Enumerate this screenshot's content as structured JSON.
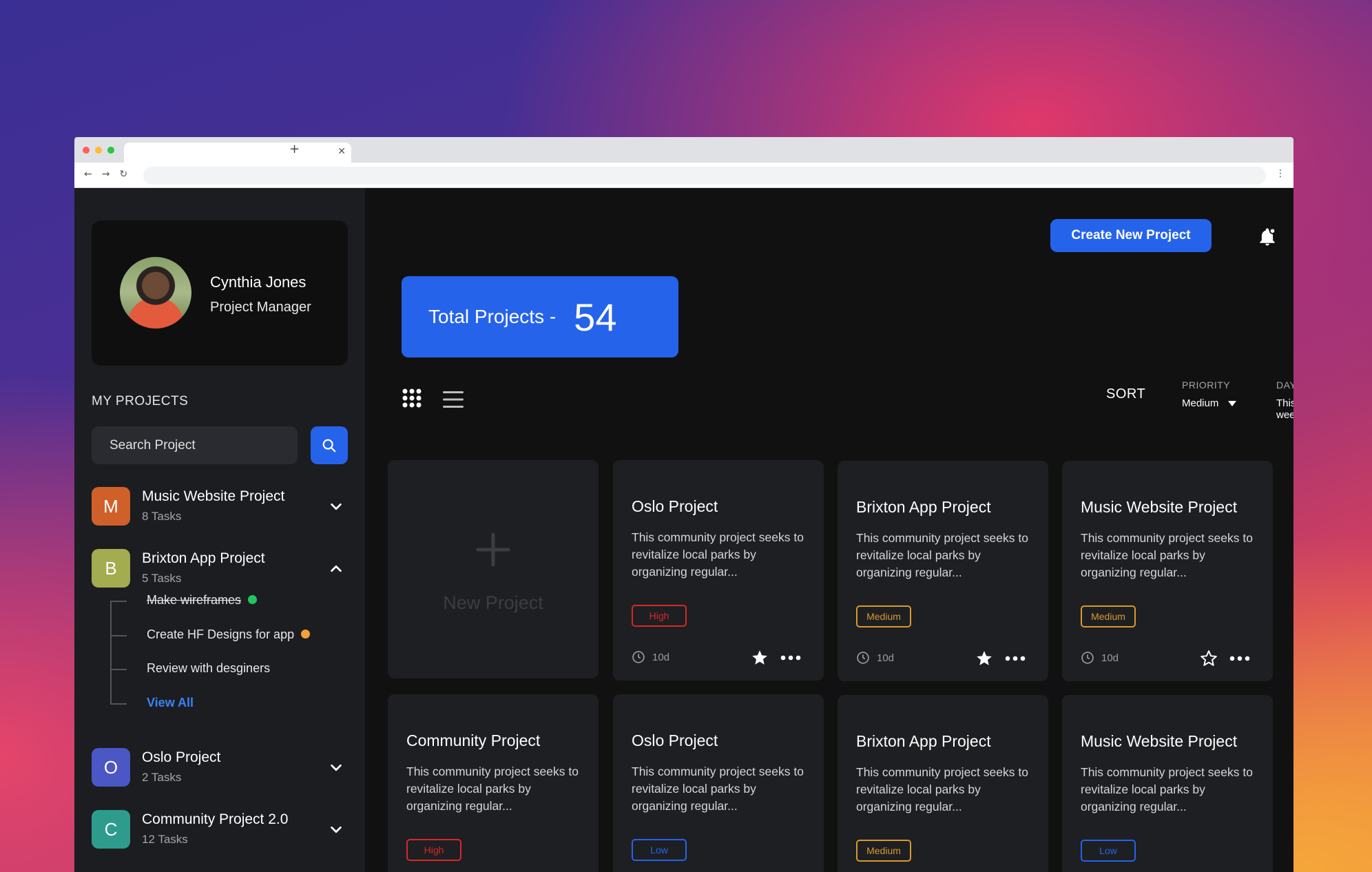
{
  "profile": {
    "name": "Cynthia Jones",
    "role": "Project Manager"
  },
  "sidebar": {
    "heading": "MY PROJECTS",
    "search_placeholder": "Search Project",
    "projects": [
      {
        "letter": "M",
        "name": "Music Website Project",
        "tasks": "8 Tasks",
        "color": "#d0602a",
        "expanded": false
      },
      {
        "letter": "B",
        "name": "Brixton App Project",
        "tasks": "5 Tasks",
        "color": "#a3ac4f",
        "expanded": true
      },
      {
        "letter": "O",
        "name": "Oslo Project",
        "tasks": "2 Tasks",
        "color": "#4a57c4",
        "expanded": false
      },
      {
        "letter": "C",
        "name": "Community Project 2.0",
        "tasks": "12 Tasks",
        "color": "#2e9c8c",
        "expanded": false
      }
    ],
    "subtasks": [
      {
        "text": "Make wireframes",
        "done": true,
        "dot": "#22c55e"
      },
      {
        "text": "Create HF Designs for app",
        "done": false,
        "dot": "#f5a13a"
      },
      {
        "text": "Review with desginers",
        "done": false,
        "dot": ""
      }
    ],
    "view_all": "View All"
  },
  "header": {
    "create_button": "Create New Project"
  },
  "summary": {
    "label": "Total Projects -",
    "count": "54"
  },
  "sort": {
    "label": "SORT",
    "priority": {
      "label": "PRIORITY",
      "value": "Medium"
    },
    "days": {
      "label": "DAYS",
      "value": "This week"
    }
  },
  "new_project": {
    "label": "New Project"
  },
  "cards": [
    {
      "title": "Oslo Project",
      "desc": "This community project seeks to revitalize local parks by organizing regular...",
      "priority": "High",
      "time": "10d",
      "starred": true
    },
    {
      "title": "Brixton App Project",
      "desc": "This community project seeks to revitalize local parks by organizing regular...",
      "priority": "Medium",
      "time": "10d",
      "starred": true
    },
    {
      "title": "Music Website Project",
      "desc": "This community project seeks to revitalize local parks by organizing regular...",
      "priority": "Medium",
      "time": "10d",
      "starred": false
    },
    {
      "title": "Community Project",
      "desc": "This community project seeks to revitalize local parks by organizing regular...",
      "priority": "High",
      "time": "",
      "starred": false
    },
    {
      "title": "Oslo Project",
      "desc": "This community project seeks to revitalize local parks by organizing regular...",
      "priority": "Low",
      "time": "",
      "starred": false
    },
    {
      "title": "Brixton App Project",
      "desc": "This community project seeks to revitalize local parks by organizing regular...",
      "priority": "Medium",
      "time": "",
      "starred": false
    },
    {
      "title": "Music Website Project",
      "desc": "This community project seeks to revitalize local parks by organizing regular...",
      "priority": "Low",
      "time": "",
      "starred": false
    }
  ],
  "colors": {
    "accent": "#2563eb",
    "high": "#dc2626",
    "medium": "#d99a2b",
    "low": "#2563eb"
  }
}
